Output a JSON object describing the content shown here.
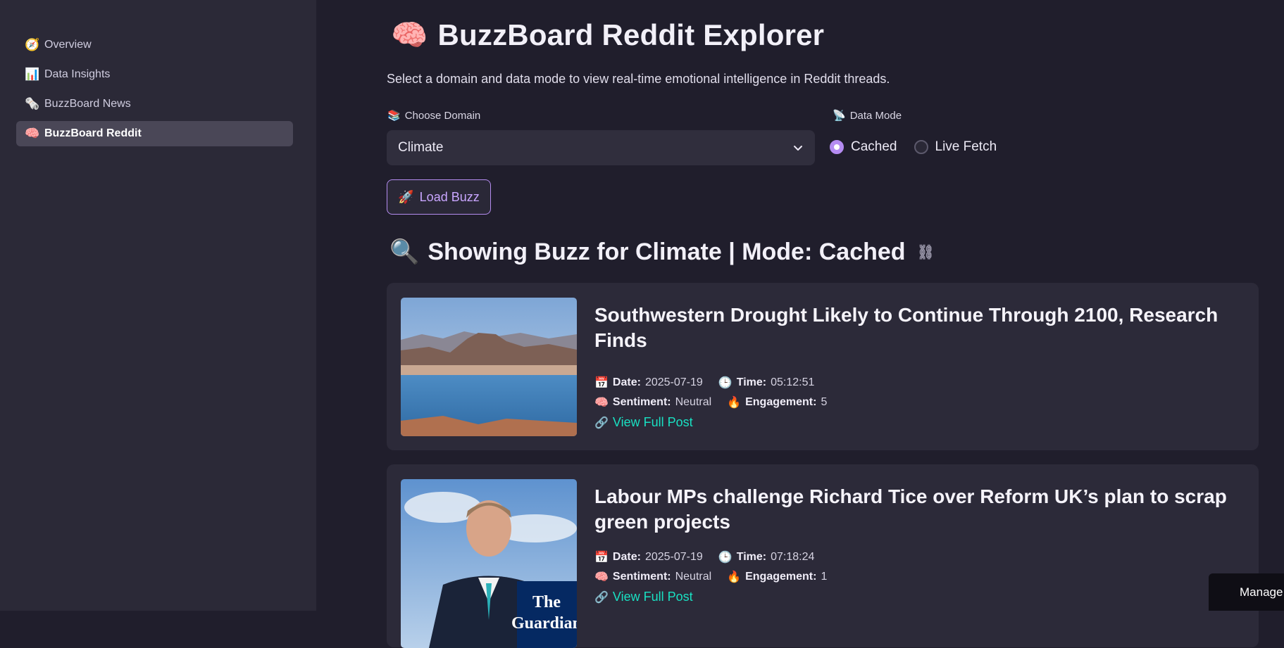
{
  "sidebar": {
    "items": [
      {
        "icon": "🧭",
        "label": "Overview"
      },
      {
        "icon": "📊",
        "label": "Data Insights"
      },
      {
        "icon": "🗞️",
        "label": "BuzzBoard News"
      },
      {
        "icon": "🧠",
        "label": "BuzzBoard Reddit"
      }
    ],
    "active_index": 3
  },
  "header": {
    "emoji": "🧠",
    "title": "BuzzBoard Reddit Explorer",
    "subtitle": "Select a domain and data mode to view real-time emotional intelligence in Reddit threads."
  },
  "controls": {
    "domain_label_icon": "📚",
    "domain_label": "Choose Domain",
    "domain_value": "Climate",
    "mode_label_icon": "📡",
    "mode_label": "Data Mode",
    "mode_options": [
      "Cached",
      "Live Fetch"
    ],
    "mode_selected": "Cached",
    "load_icon": "🚀",
    "load_label": "Load Buzz"
  },
  "results": {
    "icon": "🔍",
    "heading": "Showing Buzz for Climate | Mode: Cached",
    "posts": [
      {
        "title": "Southwestern Drought Likely to Continue Through 2100, Research Finds",
        "date_label": "Date:",
        "date": "2025-07-19",
        "time_label": "Time:",
        "time": "05:12:51",
        "sentiment_label": "Sentiment:",
        "sentiment": "Neutral",
        "engagement_label": "Engagement:",
        "engagement": "5",
        "link_label": "View Full Post"
      },
      {
        "title": "Labour MPs challenge Richard Tice over Reform UK’s plan to scrap green projects",
        "date_label": "Date:",
        "date": "2025-07-19",
        "time_label": "Time:",
        "time": "07:18:24",
        "sentiment_label": "Sentiment:",
        "sentiment": "Neutral",
        "engagement_label": "Engagement:",
        "engagement": "1",
        "link_label": "View Full Post",
        "image_text": "The Guardian"
      }
    ]
  },
  "manage": {
    "label": "Manage app"
  },
  "colors": {
    "accent": "#b58cf2",
    "link": "#19e0c2",
    "background": "#201e2c",
    "sidebar": "#2b2937"
  }
}
